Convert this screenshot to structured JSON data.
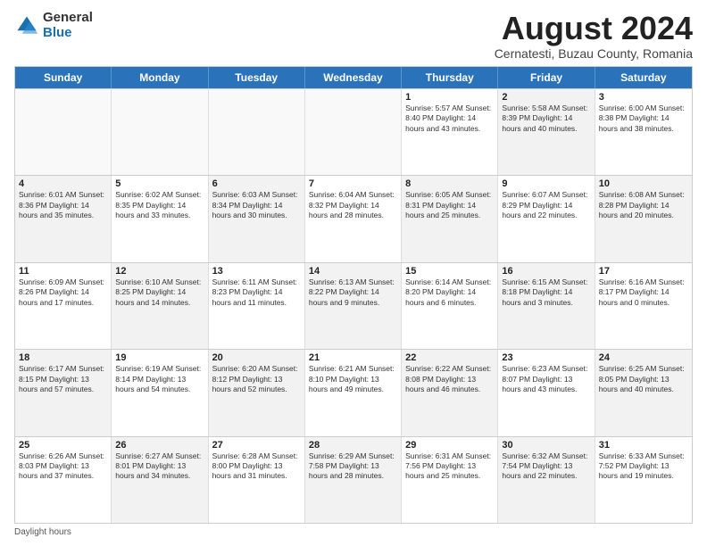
{
  "logo": {
    "general": "General",
    "blue": "Blue"
  },
  "title": "August 2024",
  "subtitle": "Cernatesti, Buzau County, Romania",
  "days_of_week": [
    "Sunday",
    "Monday",
    "Tuesday",
    "Wednesday",
    "Thursday",
    "Friday",
    "Saturday"
  ],
  "footer": "Daylight hours",
  "weeks": [
    [
      {
        "day": "",
        "info": "",
        "shaded": false,
        "empty": true
      },
      {
        "day": "",
        "info": "",
        "shaded": false,
        "empty": true
      },
      {
        "day": "",
        "info": "",
        "shaded": false,
        "empty": true
      },
      {
        "day": "",
        "info": "",
        "shaded": false,
        "empty": true
      },
      {
        "day": "1",
        "info": "Sunrise: 5:57 AM\nSunset: 8:40 PM\nDaylight: 14 hours\nand 43 minutes.",
        "shaded": false,
        "empty": false
      },
      {
        "day": "2",
        "info": "Sunrise: 5:58 AM\nSunset: 8:39 PM\nDaylight: 14 hours\nand 40 minutes.",
        "shaded": true,
        "empty": false
      },
      {
        "day": "3",
        "info": "Sunrise: 6:00 AM\nSunset: 8:38 PM\nDaylight: 14 hours\nand 38 minutes.",
        "shaded": false,
        "empty": false
      }
    ],
    [
      {
        "day": "4",
        "info": "Sunrise: 6:01 AM\nSunset: 8:36 PM\nDaylight: 14 hours\nand 35 minutes.",
        "shaded": true,
        "empty": false
      },
      {
        "day": "5",
        "info": "Sunrise: 6:02 AM\nSunset: 8:35 PM\nDaylight: 14 hours\nand 33 minutes.",
        "shaded": false,
        "empty": false
      },
      {
        "day": "6",
        "info": "Sunrise: 6:03 AM\nSunset: 8:34 PM\nDaylight: 14 hours\nand 30 minutes.",
        "shaded": true,
        "empty": false
      },
      {
        "day": "7",
        "info": "Sunrise: 6:04 AM\nSunset: 8:32 PM\nDaylight: 14 hours\nand 28 minutes.",
        "shaded": false,
        "empty": false
      },
      {
        "day": "8",
        "info": "Sunrise: 6:05 AM\nSunset: 8:31 PM\nDaylight: 14 hours\nand 25 minutes.",
        "shaded": true,
        "empty": false
      },
      {
        "day": "9",
        "info": "Sunrise: 6:07 AM\nSunset: 8:29 PM\nDaylight: 14 hours\nand 22 minutes.",
        "shaded": false,
        "empty": false
      },
      {
        "day": "10",
        "info": "Sunrise: 6:08 AM\nSunset: 8:28 PM\nDaylight: 14 hours\nand 20 minutes.",
        "shaded": true,
        "empty": false
      }
    ],
    [
      {
        "day": "11",
        "info": "Sunrise: 6:09 AM\nSunset: 8:26 PM\nDaylight: 14 hours\nand 17 minutes.",
        "shaded": false,
        "empty": false
      },
      {
        "day": "12",
        "info": "Sunrise: 6:10 AM\nSunset: 8:25 PM\nDaylight: 14 hours\nand 14 minutes.",
        "shaded": true,
        "empty": false
      },
      {
        "day": "13",
        "info": "Sunrise: 6:11 AM\nSunset: 8:23 PM\nDaylight: 14 hours\nand 11 minutes.",
        "shaded": false,
        "empty": false
      },
      {
        "day": "14",
        "info": "Sunrise: 6:13 AM\nSunset: 8:22 PM\nDaylight: 14 hours\nand 9 minutes.",
        "shaded": true,
        "empty": false
      },
      {
        "day": "15",
        "info": "Sunrise: 6:14 AM\nSunset: 8:20 PM\nDaylight: 14 hours\nand 6 minutes.",
        "shaded": false,
        "empty": false
      },
      {
        "day": "16",
        "info": "Sunrise: 6:15 AM\nSunset: 8:18 PM\nDaylight: 14 hours\nand 3 minutes.",
        "shaded": true,
        "empty": false
      },
      {
        "day": "17",
        "info": "Sunrise: 6:16 AM\nSunset: 8:17 PM\nDaylight: 14 hours\nand 0 minutes.",
        "shaded": false,
        "empty": false
      }
    ],
    [
      {
        "day": "18",
        "info": "Sunrise: 6:17 AM\nSunset: 8:15 PM\nDaylight: 13 hours\nand 57 minutes.",
        "shaded": true,
        "empty": false
      },
      {
        "day": "19",
        "info": "Sunrise: 6:19 AM\nSunset: 8:14 PM\nDaylight: 13 hours\nand 54 minutes.",
        "shaded": false,
        "empty": false
      },
      {
        "day": "20",
        "info": "Sunrise: 6:20 AM\nSunset: 8:12 PM\nDaylight: 13 hours\nand 52 minutes.",
        "shaded": true,
        "empty": false
      },
      {
        "day": "21",
        "info": "Sunrise: 6:21 AM\nSunset: 8:10 PM\nDaylight: 13 hours\nand 49 minutes.",
        "shaded": false,
        "empty": false
      },
      {
        "day": "22",
        "info": "Sunrise: 6:22 AM\nSunset: 8:08 PM\nDaylight: 13 hours\nand 46 minutes.",
        "shaded": true,
        "empty": false
      },
      {
        "day": "23",
        "info": "Sunrise: 6:23 AM\nSunset: 8:07 PM\nDaylight: 13 hours\nand 43 minutes.",
        "shaded": false,
        "empty": false
      },
      {
        "day": "24",
        "info": "Sunrise: 6:25 AM\nSunset: 8:05 PM\nDaylight: 13 hours\nand 40 minutes.",
        "shaded": true,
        "empty": false
      }
    ],
    [
      {
        "day": "25",
        "info": "Sunrise: 6:26 AM\nSunset: 8:03 PM\nDaylight: 13 hours\nand 37 minutes.",
        "shaded": false,
        "empty": false
      },
      {
        "day": "26",
        "info": "Sunrise: 6:27 AM\nSunset: 8:01 PM\nDaylight: 13 hours\nand 34 minutes.",
        "shaded": true,
        "empty": false
      },
      {
        "day": "27",
        "info": "Sunrise: 6:28 AM\nSunset: 8:00 PM\nDaylight: 13 hours\nand 31 minutes.",
        "shaded": false,
        "empty": false
      },
      {
        "day": "28",
        "info": "Sunrise: 6:29 AM\nSunset: 7:58 PM\nDaylight: 13 hours\nand 28 minutes.",
        "shaded": true,
        "empty": false
      },
      {
        "day": "29",
        "info": "Sunrise: 6:31 AM\nSunset: 7:56 PM\nDaylight: 13 hours\nand 25 minutes.",
        "shaded": false,
        "empty": false
      },
      {
        "day": "30",
        "info": "Sunrise: 6:32 AM\nSunset: 7:54 PM\nDaylight: 13 hours\nand 22 minutes.",
        "shaded": true,
        "empty": false
      },
      {
        "day": "31",
        "info": "Sunrise: 6:33 AM\nSunset: 7:52 PM\nDaylight: 13 hours\nand 19 minutes.",
        "shaded": false,
        "empty": false
      }
    ]
  ]
}
